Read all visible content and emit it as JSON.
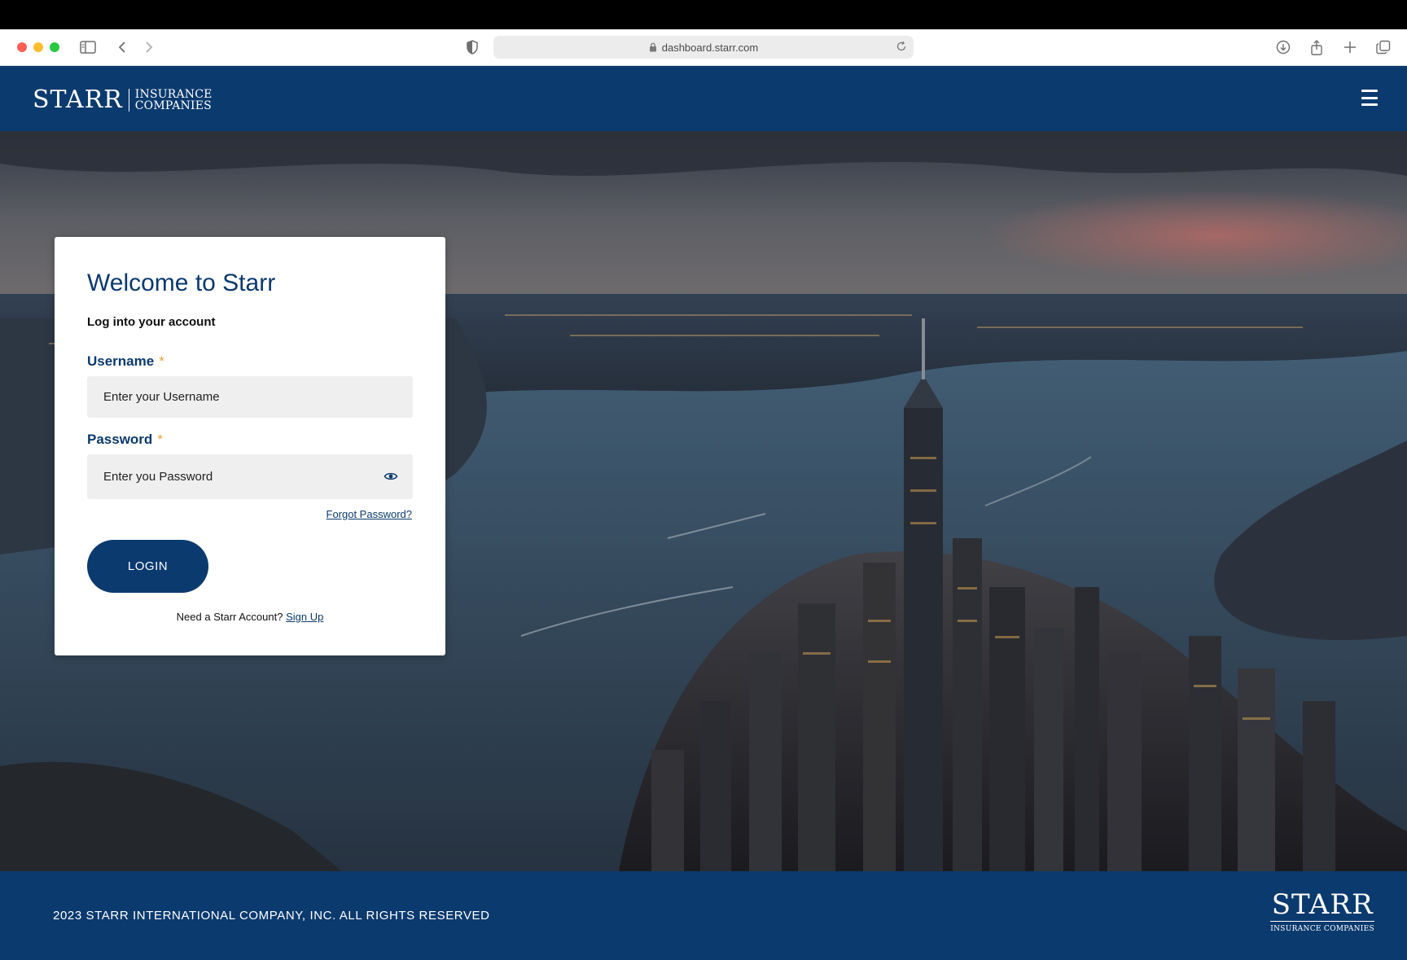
{
  "browser": {
    "url": "dashboard.starr.com",
    "traffic_lights": [
      "#ff5f57",
      "#febc2e",
      "#28c840"
    ]
  },
  "header": {
    "logo_main": "STARR",
    "logo_line1": "INSURANCE",
    "logo_line2": "COMPANIES",
    "menu_icon": "hamburger-menu-icon",
    "background": "#0b3a6e"
  },
  "login": {
    "title": "Welcome to Starr",
    "subtitle": "Log into your account",
    "username_label": "Username",
    "username_placeholder": "Enter your Username",
    "password_label": "Password",
    "password_placeholder": "Enter you Password",
    "required_marker": "*",
    "forgot_password": "Forgot Password?",
    "login_button": "LOGIN",
    "signup_prompt": "Need a Starr Account?",
    "signup_link": "Sign Up",
    "accent": "#0b3a6e",
    "required_color": "#e6a23c"
  },
  "footer": {
    "copyright": "2023 STARR INTERNATIONAL COMPANY, INC. ALL RIGHTS RESERVED",
    "logo_main": "STARR",
    "logo_sub": "INSURANCE COMPANIES"
  }
}
